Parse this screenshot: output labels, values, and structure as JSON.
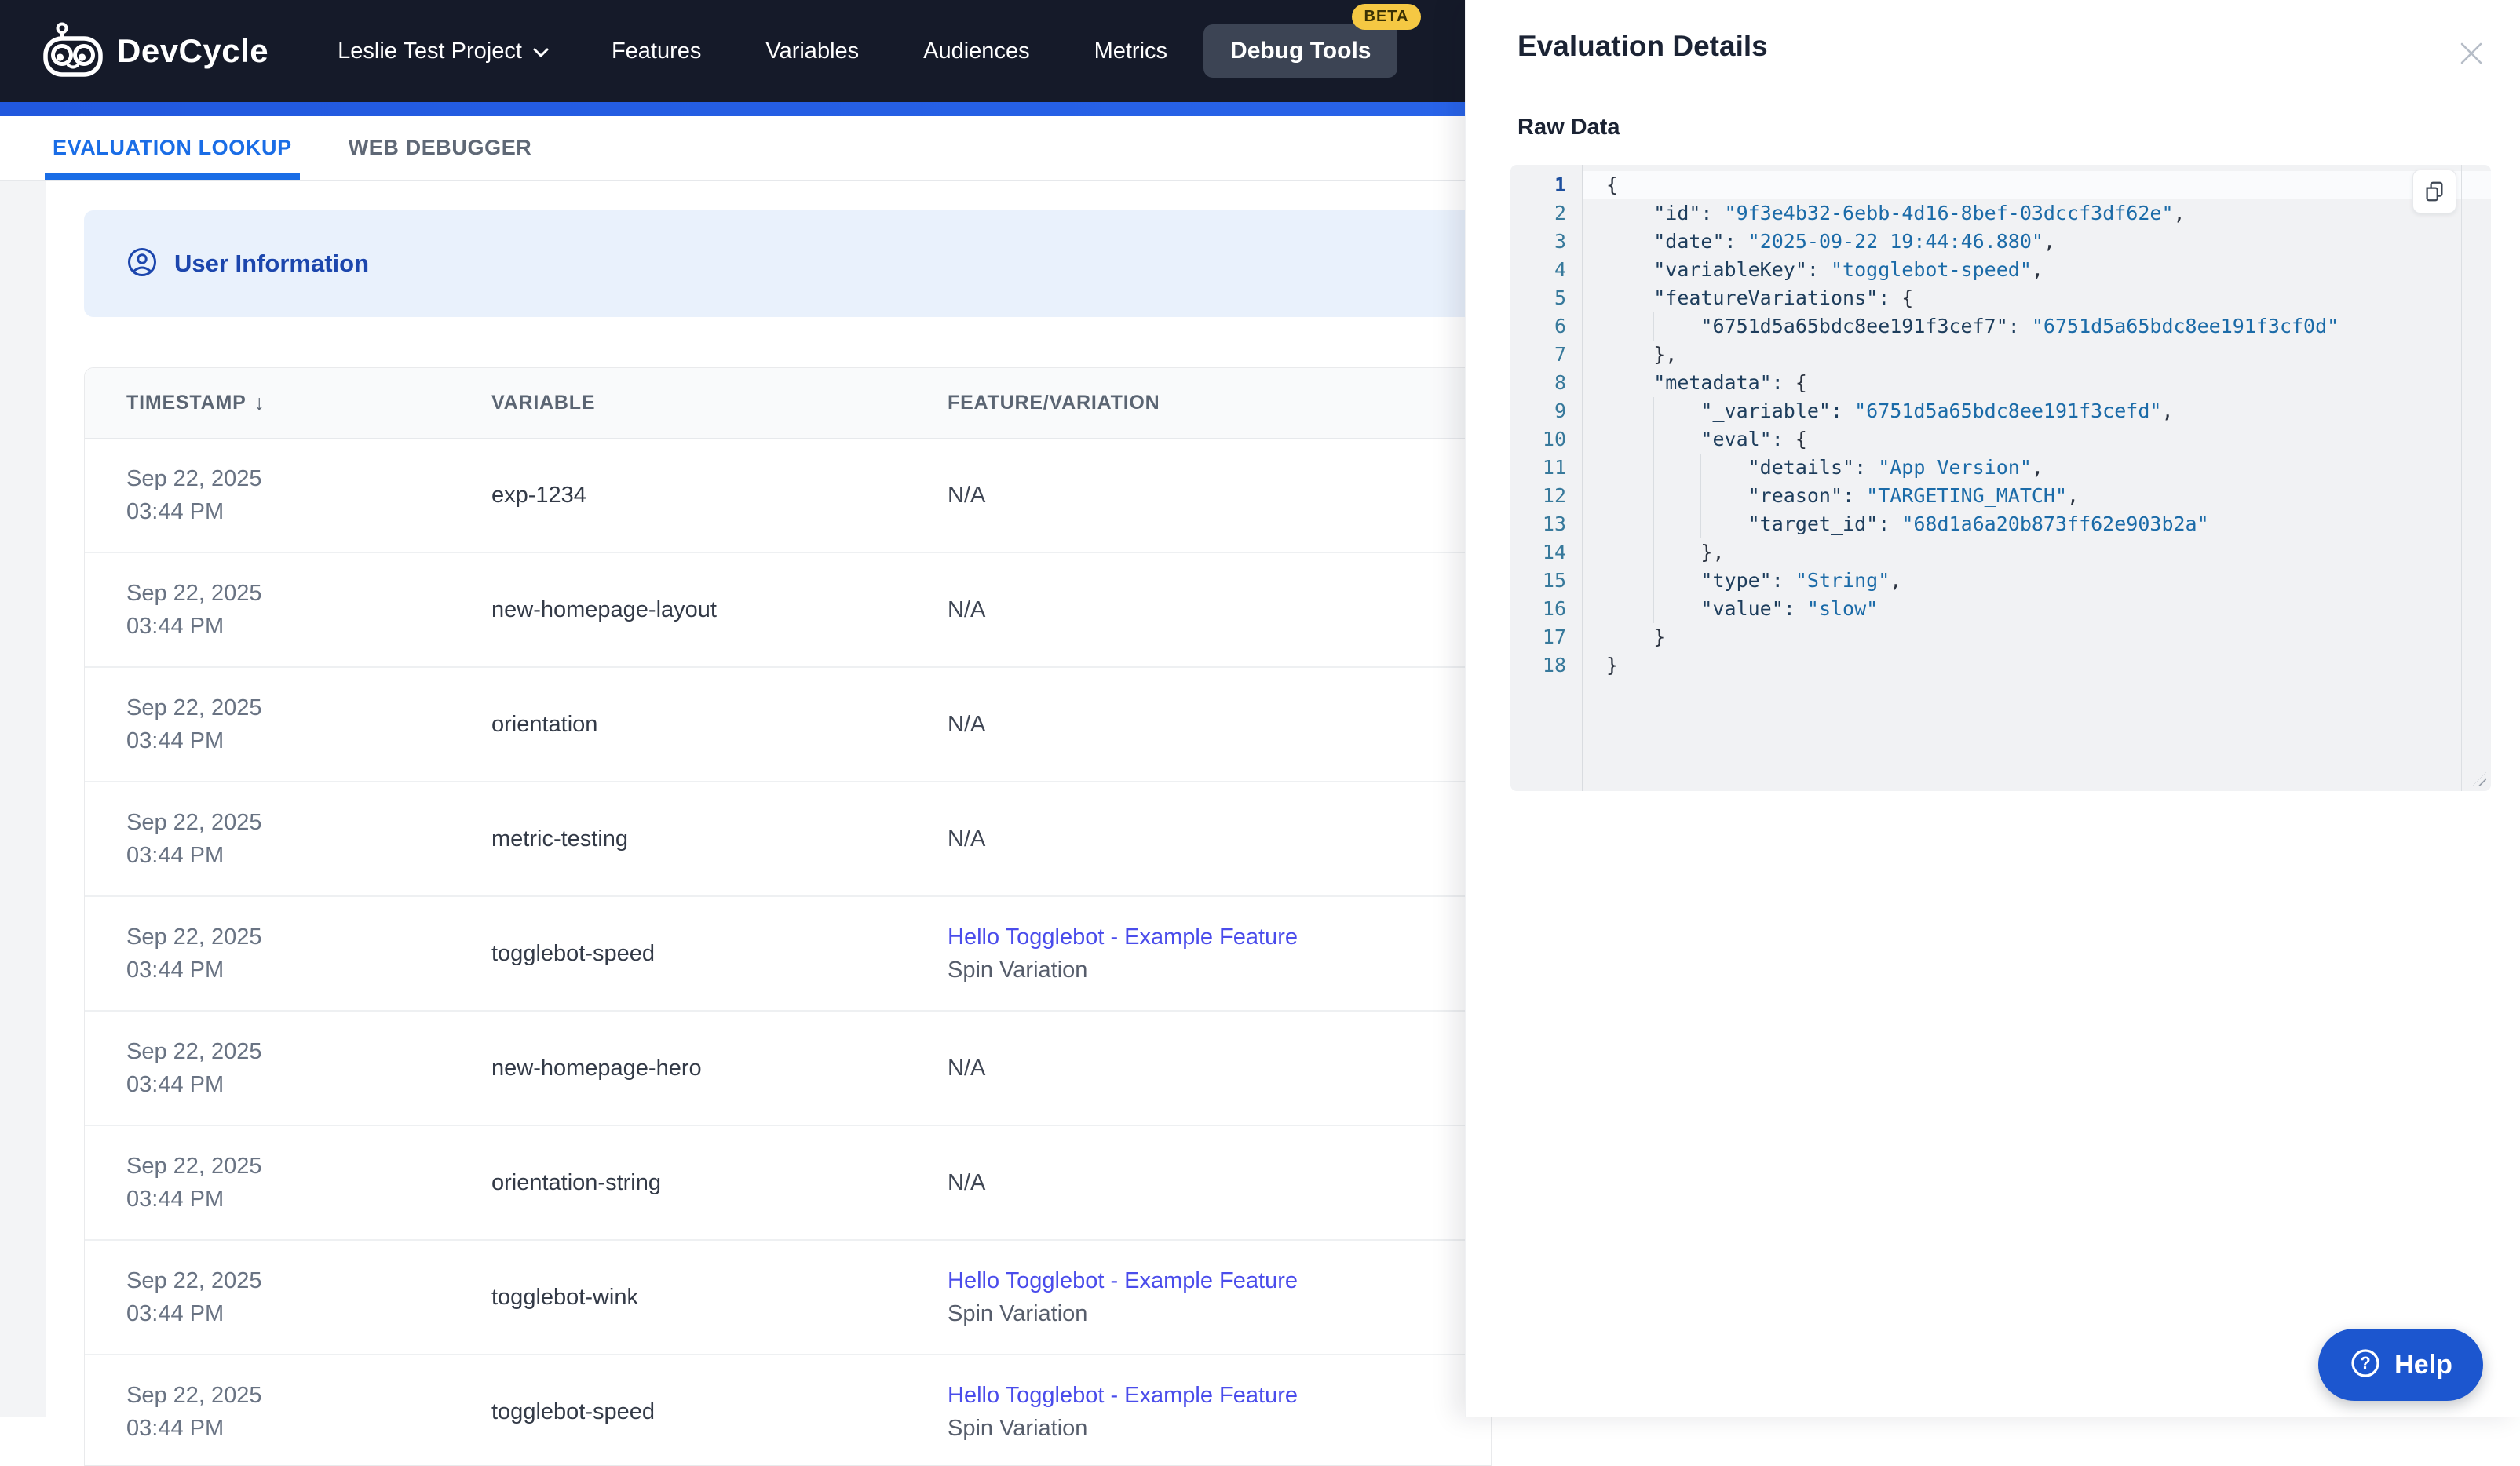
{
  "colors": {
    "nav_bg": "#151a29",
    "tab_active": "#1a6de6",
    "link_blue": "#4a4ceb",
    "banner_bg": "#e9f1fc",
    "banner_text": "#1c46ad",
    "beta_bg": "#f5c843",
    "help_bg": "#1c56cf",
    "code_bg": "#f1f2f4",
    "code_key": "#1d3d5c",
    "code_string": "#1b6ba8",
    "line_number": "#37799b"
  },
  "nav": {
    "brand": "DevCycle",
    "project_selector": "Leslie Test Project",
    "links": [
      "Features",
      "Variables",
      "Audiences",
      "Metrics"
    ],
    "debug_tools": "Debug Tools",
    "beta_badge": "BETA"
  },
  "tabs": [
    {
      "label": "EVALUATION LOOKUP",
      "active": true
    },
    {
      "label": "WEB DEBUGGER",
      "active": false
    }
  ],
  "banner": {
    "label": "User Information"
  },
  "table": {
    "columns": [
      {
        "label": "TIMESTAMP",
        "sort": "↓"
      },
      {
        "label": "VARIABLE"
      },
      {
        "label": "FEATURE/VARIATION"
      }
    ],
    "empty_value": "N/A",
    "rows": [
      {
        "date": "Sep 22, 2025",
        "time": "03:44 PM",
        "variable": "exp-1234",
        "feature": null,
        "variation": null
      },
      {
        "date": "Sep 22, 2025",
        "time": "03:44 PM",
        "variable": "new-homepage-layout",
        "feature": null,
        "variation": null
      },
      {
        "date": "Sep 22, 2025",
        "time": "03:44 PM",
        "variable": "orientation",
        "feature": null,
        "variation": null
      },
      {
        "date": "Sep 22, 2025",
        "time": "03:44 PM",
        "variable": "metric-testing",
        "feature": null,
        "variation": null
      },
      {
        "date": "Sep 22, 2025",
        "time": "03:44 PM",
        "variable": "togglebot-speed",
        "feature": "Hello Togglebot - Example Feature",
        "variation": "Spin Variation"
      },
      {
        "date": "Sep 22, 2025",
        "time": "03:44 PM",
        "variable": "new-homepage-hero",
        "feature": null,
        "variation": null
      },
      {
        "date": "Sep 22, 2025",
        "time": "03:44 PM",
        "variable": "orientation-string",
        "feature": null,
        "variation": null
      },
      {
        "date": "Sep 22, 2025",
        "time": "03:44 PM",
        "variable": "togglebot-wink",
        "feature": "Hello Togglebot - Example Feature",
        "variation": "Spin Variation"
      },
      {
        "date": "Sep 22, 2025",
        "time": "03:44 PM",
        "variable": "togglebot-speed",
        "feature": "Hello Togglebot - Example Feature",
        "variation": "Spin Variation"
      }
    ]
  },
  "panel": {
    "title": "Evaluation Details",
    "section_label": "Raw Data",
    "code_lines": [
      "{",
      "    \"id\": \"9f3e4b32-6ebb-4d16-8bef-03dccf3df62e\",",
      "    \"date\": \"2025-09-22 19:44:46.880\",",
      "    \"variableKey\": \"togglebot-speed\",",
      "    \"featureVariations\": {",
      "        \"6751d5a65bdc8ee191f3cef7\": \"6751d5a65bdc8ee191f3cf0d\"",
      "    },",
      "    \"metadata\": {",
      "        \"_variable\": \"6751d5a65bdc8ee191f3cefd\",",
      "        \"eval\": {",
      "            \"details\": \"App Version\",",
      "            \"reason\": \"TARGETING_MATCH\",",
      "            \"target_id\": \"68d1a6a20b873ff62e903b2a\"",
      "        },",
      "        \"type\": \"String\",",
      "        \"value\": \"slow\"",
      "    }",
      "}"
    ]
  },
  "help": {
    "label": "Help"
  }
}
